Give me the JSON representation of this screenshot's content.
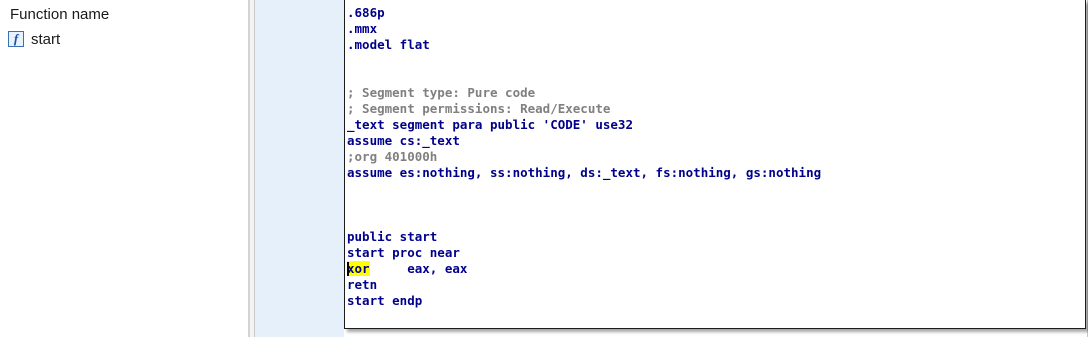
{
  "functions_window": {
    "header": "Function name",
    "items": [
      {
        "icon": "function-icon",
        "icon_glyph": "f",
        "name": "start"
      }
    ]
  },
  "disassembly": {
    "lines": [
      ".686p",
      ".mmx",
      ".model flat",
      "",
      "",
      "; Segment type: Pure code",
      "; Segment permissions: Read/Execute",
      "_text segment para public 'CODE' use32",
      "assume cs:_text",
      ";org 401000h",
      "assume es:nothing, ss:nothing, ds:_text, fs:nothing, gs:nothing",
      "",
      "",
      "",
      "public start",
      "start proc near",
      {
        "mnemonic": "xor",
        "operands": "     eax, eax"
      },
      "retn",
      "start endp"
    ],
    "highlight_color": "#ffff00",
    "code_color": "#00008b",
    "comment_color": "#808080"
  }
}
